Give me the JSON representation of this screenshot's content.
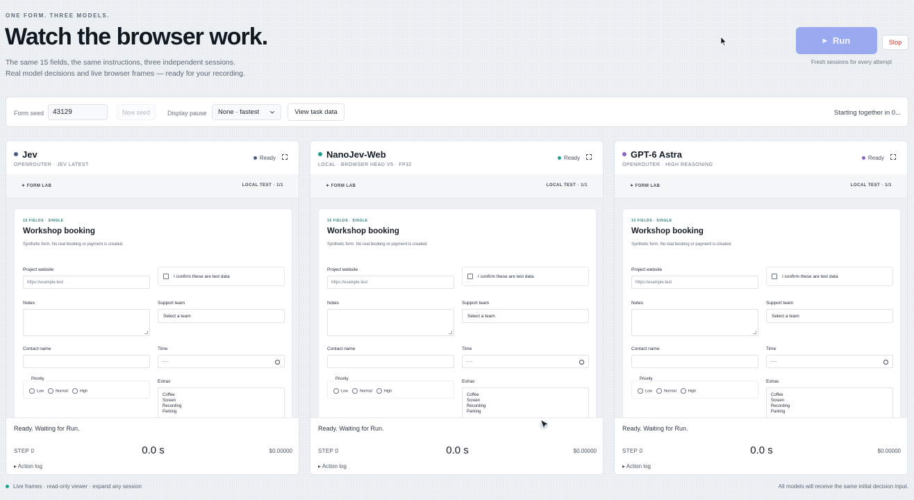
{
  "header": {
    "eyebrow": "ONE FORM. THREE MODELS.",
    "title": "Watch the browser work.",
    "subtitle_line1": "The same 15 fields, the same instructions, three independent sessions.",
    "subtitle_line2": "Real model decisions and live browser frames — ready for your recording.",
    "run_label": "Run",
    "run_icon": "play-icon",
    "stop_label": "Stop",
    "fresh_note": "Fresh sessions for every attempt"
  },
  "controls": {
    "seed_label": "Form seed",
    "seed_value": "43129",
    "new_seed_label": "New seed",
    "pause_label": "Display pause",
    "pause_value": "None · fastest",
    "view_label": "View task data",
    "starting_text": "Starting together in 0..."
  },
  "colors": {
    "accent": "#9aaaf0",
    "stop": "#c0392b",
    "jev": "#4a5a86",
    "nanojev": "#1f9e8c",
    "gpt6": "#8a63c9",
    "ready_jev": "#4a5a86",
    "ready_nano": "#1f9e8c",
    "ready_gpt": "#8a63c9"
  },
  "form": {
    "eyebrow": "15 FIELDS · SINGLE",
    "title": "Workshop booking",
    "desc": "Synthetic form. No real booking or payment is created.",
    "website_label": "Project website",
    "website_placeholder": "https://example.test",
    "confirm_label": "I confirm these are test data",
    "notes_label": "Notes",
    "support_label": "Support team",
    "support_value": "Select a team",
    "contact_label": "Contact name",
    "time_label": "Time",
    "time_value": "--:--",
    "priority_label": "Priority",
    "priority_options": [
      "Low",
      "Normal",
      "High"
    ],
    "extras_label": "Extras",
    "extras_options": [
      "Coffee",
      "Screen",
      "Recording",
      "Parking"
    ]
  },
  "panels": [
    {
      "name": "Jev",
      "sub": "OPENROUTER · JEV LATEST",
      "status": "Ready",
      "bar_left": "✦ FORM LAB",
      "bar_right": "LOCAL TEST · 1/1",
      "message": "Ready. Waiting for Run.",
      "step": "STEP 0",
      "time": "0.0 s",
      "cost": "$0.00000",
      "log": "▸ Action log"
    },
    {
      "name": "NanoJev-Web",
      "sub": "LOCAL · BROWSER HEAD V5 · FP32",
      "status": "Ready",
      "bar_left": "✦ FORM LAB",
      "bar_right": "LOCAL TEST · 1/1",
      "message": "Ready. Waiting for Run.",
      "step": "STEP 0",
      "time": "0.0 s",
      "cost": "$0.00000",
      "log": "▸ Action log"
    },
    {
      "name": "GPT-6 Astra",
      "sub": "OPENROUTER · HIGH REASONING",
      "status": "Ready",
      "bar_left": "✦ FORM LAB",
      "bar_right": "LOCAL TEST · 1/1",
      "message": "Ready. Waiting for Run.",
      "step": "STEP 0",
      "time": "0.0 s",
      "cost": "$0.00000",
      "log": "▸ Action log"
    }
  ],
  "footer": {
    "left": "Live frames · read-only viewer · expand any session",
    "right": "All models will receive the same initial decision input."
  }
}
